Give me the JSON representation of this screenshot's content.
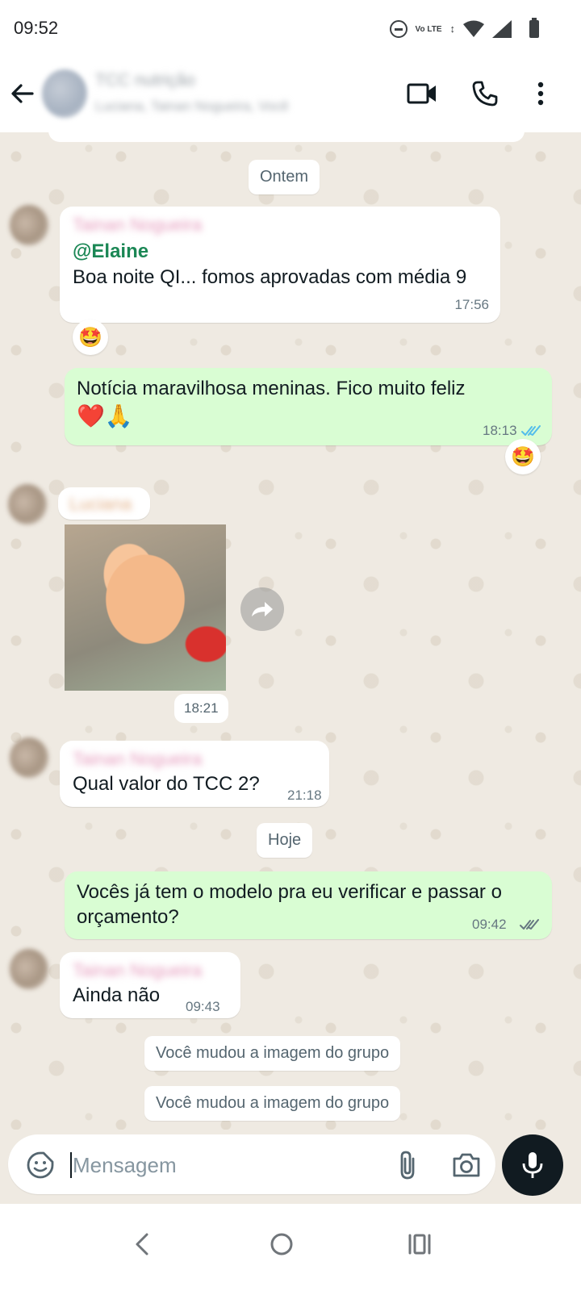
{
  "status_bar": {
    "time": "09:52",
    "network_label": "Vo LTE"
  },
  "header": {
    "group_name": "TCC nutrição",
    "members": "Luciana, Tainan Nogueira, Você"
  },
  "chat": {
    "date_yesterday": "Ontem",
    "date_today": "Hoje",
    "messages": [
      {
        "sender": "Tainan Nogueira",
        "mention": "@Elaine",
        "text": "Boa noite QI... fomos aprovadas com média 9",
        "time": "17:56",
        "reaction": "🤩"
      },
      {
        "text": "Notícia maravilhosa meninas. Fico muito feliz",
        "emojis": "❤️🙏",
        "time": "18:13",
        "status": "read",
        "reaction": "🤩"
      },
      {
        "sender": "Luciana",
        "type": "sticker",
        "time": "18:21"
      },
      {
        "sender": "Tainan Nogueira",
        "text": "Qual valor do TCC 2?",
        "time": "21:18"
      },
      {
        "text": "Vocês já tem o modelo pra eu verificar e passar o orçamento?",
        "time": "09:42",
        "status": "delivered"
      },
      {
        "sender": "Tainan Nogueira",
        "text": "Ainda não",
        "time": "09:43"
      }
    ],
    "system_messages": [
      "Você mudou a imagem do grupo",
      "Você mudou a imagem do grupo"
    ]
  },
  "input": {
    "placeholder": "Mensagem",
    "value": ""
  },
  "colors": {
    "outgoing_bubble": "#d9fdd3",
    "incoming_bubble": "#ffffff",
    "mention": "#1b8755",
    "read_ticks": "#53bdeb",
    "chat_bg": "#efeae2"
  },
  "icons": {
    "back": "arrow-left-icon",
    "video": "video-call-icon",
    "call": "phone-icon",
    "menu": "more-vert-icon",
    "emoji": "sticker-smile-icon",
    "attach": "paperclip-icon",
    "camera": "camera-icon",
    "mic": "microphone-icon",
    "forward": "forward-icon"
  }
}
